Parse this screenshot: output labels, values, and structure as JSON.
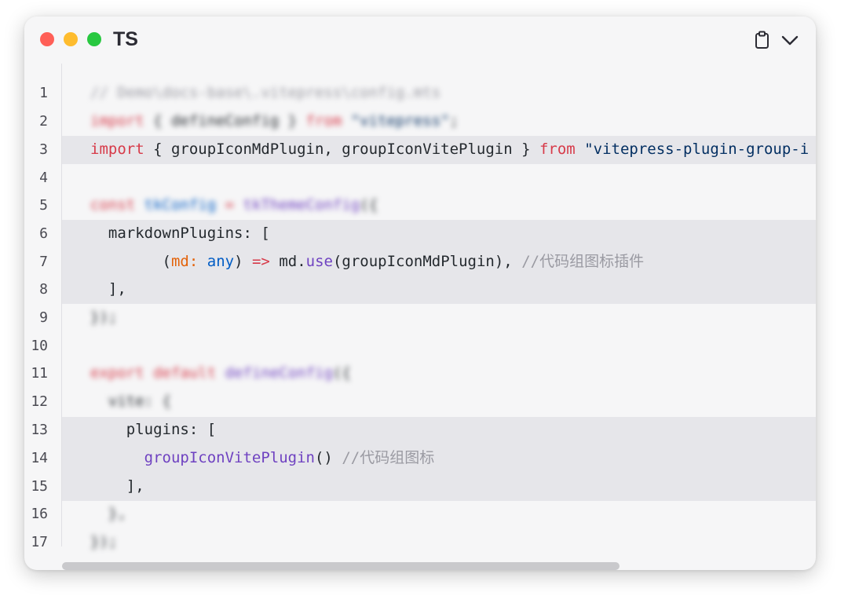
{
  "header": {
    "language_label": "TS",
    "window_controls": [
      "close",
      "minimize",
      "maximize"
    ],
    "copy_icon": "clipboard-icon",
    "collapse_icon": "chevron-down-icon"
  },
  "line_numbers": [
    "1",
    "2",
    "3",
    "4",
    "5",
    "6",
    "7",
    "8",
    "9",
    "10",
    "11",
    "12",
    "13",
    "14",
    "15",
    "16",
    "17"
  ],
  "code": {
    "l1": {
      "comment": "// Demo\\docs-base\\.vitepress\\config.mts"
    },
    "l2": {
      "kw1": "import",
      "mid": " { defineConfig } ",
      "kw2": "from",
      "sp": " ",
      "str": "\"vitepress\"",
      "end": ";"
    },
    "l3": {
      "kw1": "import",
      "mid": " { groupIconMdPlugin, groupIconVitePlugin } ",
      "kw2": "from",
      "sp": " ",
      "str": "\"vitepress-plugin-group-i"
    },
    "l5": {
      "kw": "const",
      "sp1": " ",
      "var": "tkConfig",
      "sp2": " ",
      "op": "=",
      "sp3": " ",
      "fn": "tkThemeConfig",
      "end": "({"
    },
    "l6": {
      "text": "  markdownPlugins: ["
    },
    "l7": {
      "indent": "        ",
      "p1": "(",
      "param": "md",
      "colon": ": ",
      "type": "any",
      "p2": ") ",
      "arrow": "=>",
      "sp": " ",
      "obj": "md.",
      "method": "use",
      "rest": "(groupIconMdPlugin), ",
      "comment": "//代码组图标插件"
    },
    "l8": {
      "text": "  ],"
    },
    "l9": {
      "text": "});"
    },
    "l11": {
      "kw1": "export",
      "sp1": " ",
      "kw2": "default",
      "sp2": " ",
      "fn": "defineConfig",
      "end": "({"
    },
    "l12": {
      "text": "  vite: {"
    },
    "l13": {
      "text": "    plugins: ["
    },
    "l14": {
      "indent": "      ",
      "fn": "groupIconVitePlugin",
      "rest": "() ",
      "comment": "//代码组图标"
    },
    "l15": {
      "text": "    ],"
    },
    "l16": {
      "text": "  },"
    },
    "l17": {
      "text": "});"
    }
  },
  "colors": {
    "keyword": "#d73a49",
    "string": "#032f62",
    "comment": "#9a9aa2",
    "function": "#6f42c1",
    "highlight_bg": "#e6e6ea"
  }
}
